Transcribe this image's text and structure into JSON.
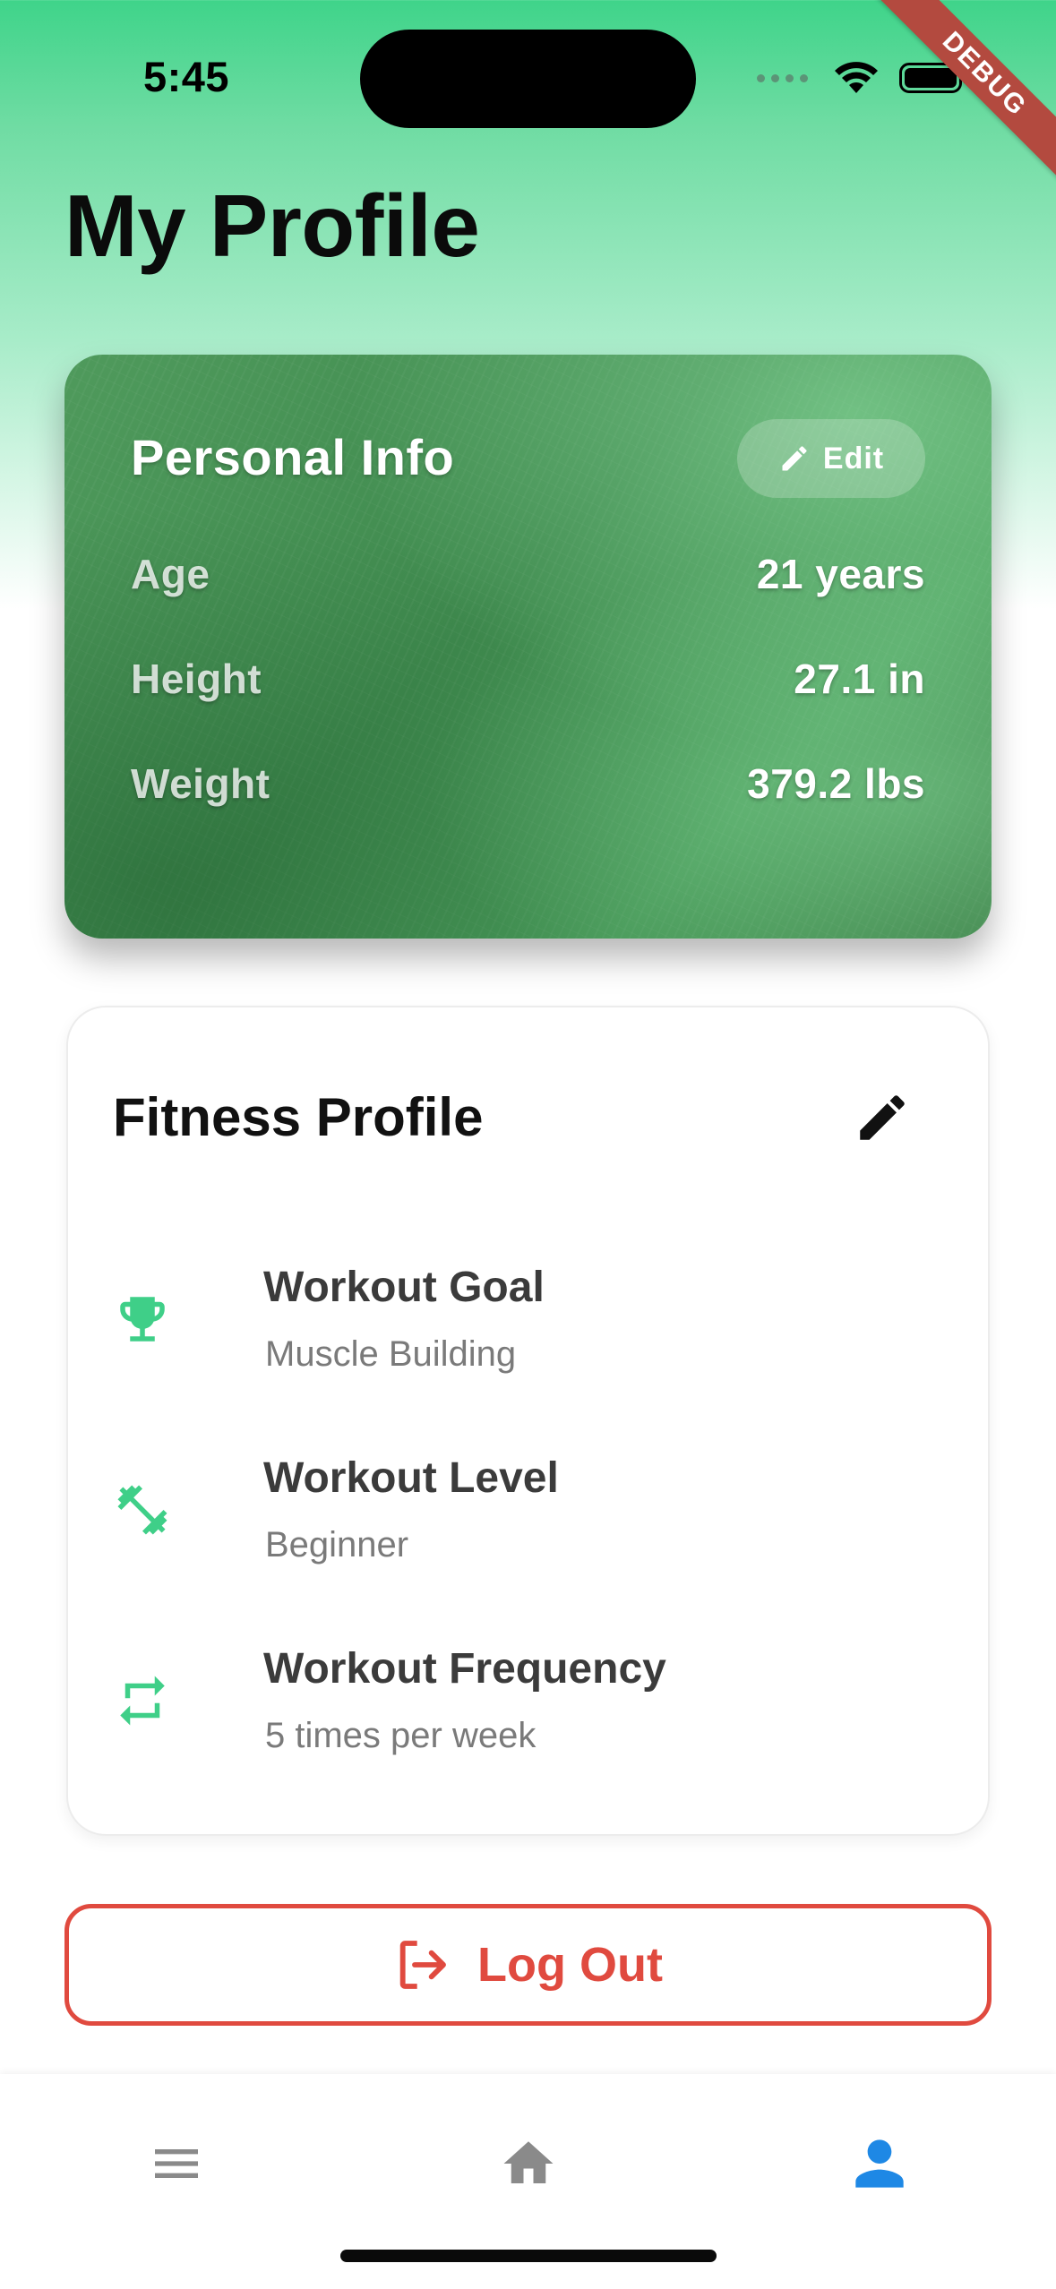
{
  "status_bar": {
    "time": "5:45"
  },
  "debug_banner": "DEBUG",
  "page": {
    "title": "My Profile"
  },
  "personal_info": {
    "heading": "Personal Info",
    "edit_label": "Edit",
    "rows": [
      {
        "label": "Age",
        "value": "21 years"
      },
      {
        "label": "Height",
        "value": "27.1 in"
      },
      {
        "label": "Weight",
        "value": "379.2 lbs"
      }
    ]
  },
  "fitness_profile": {
    "heading": "Fitness Profile",
    "items": [
      {
        "icon": "trophy-icon",
        "title": "Workout Goal",
        "value": "Muscle Building"
      },
      {
        "icon": "dumbbell-icon",
        "title": "Workout Level",
        "value": "Beginner"
      },
      {
        "icon": "repeat-icon",
        "title": "Workout Frequency",
        "value": "5 times per week"
      }
    ]
  },
  "logout": {
    "label": "Log Out"
  },
  "bottom_nav": {
    "items": [
      {
        "icon": "menu-icon",
        "active": false
      },
      {
        "icon": "home-icon",
        "active": false
      },
      {
        "icon": "profile-icon",
        "active": true
      }
    ]
  },
  "colors": {
    "accent_green": "#3fd48a",
    "danger_red": "#e04a3f",
    "active_blue": "#1e88e5",
    "inactive_gray": "#8a8a8a"
  }
}
